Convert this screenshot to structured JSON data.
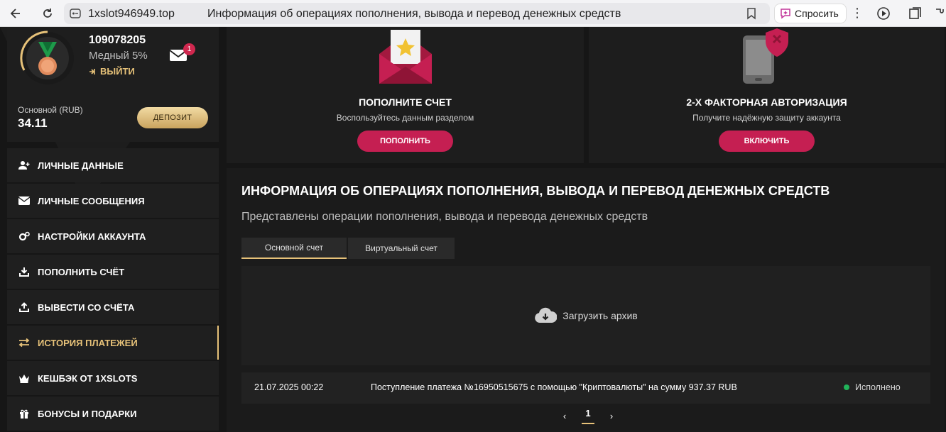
{
  "browser": {
    "url": "1xslot946949.top",
    "title": "Информация об операциях пополнения, вывода и перевод денежных средств",
    "ask_label": "Спросить"
  },
  "profile": {
    "user_id": "109078205",
    "level": "Медный 5%",
    "logout_label": "ВЫЙТИ",
    "mail_count": "1",
    "balance_label": "Основной (RUB)",
    "balance_value": "34.11",
    "deposit_label": "ДЕПОЗИТ"
  },
  "menu": {
    "items": [
      {
        "label": "ЛИЧНЫЕ ДАННЫЕ",
        "icon": "user-add-icon"
      },
      {
        "label": "ЛИЧНЫЕ СООБЩЕНИЯ",
        "icon": "envelope-icon"
      },
      {
        "label": "НАСТРОЙКИ АККАУНТА",
        "icon": "gears-icon"
      },
      {
        "label": "ПОПОЛНИТЬ СЧЁТ",
        "icon": "download-icon"
      },
      {
        "label": "ВЫВЕСТИ СО СЧЁТА",
        "icon": "upload-icon"
      },
      {
        "label": "ИСТОРИЯ ПЛАТЕЖЕЙ",
        "icon": "exchange-icon",
        "active": true
      },
      {
        "label": "КЕШБЭК ОТ 1XSLOTS",
        "icon": "crown-icon"
      },
      {
        "label": "БОНУСЫ И ПОДАРКИ",
        "icon": "gift-icon"
      }
    ]
  },
  "cards": {
    "deposit": {
      "title": "ПОПОЛНИТЕ СЧЕТ",
      "subtitle": "Воспользуйтесь данным разделом",
      "button": "ПОПОЛНИТЬ"
    },
    "twofa": {
      "title": "2-Х ФАКТОРНАЯ АВТОРИЗАЦИЯ",
      "subtitle": "Получите надёжную защиту аккаунта",
      "button": "ВКЛЮЧИТЬ"
    }
  },
  "panel": {
    "title": "ИНФОРМАЦИЯ ОБ ОПЕРАЦИЯХ ПОПОЛНЕНИЯ, ВЫВОДА И ПЕРЕВОД ДЕНЕЖНЫХ СРЕДСТВ",
    "subtitle": "Представлены операции пополнения, вывода и перевода денежных средств",
    "tabs": [
      "Основной счет",
      "Виртуальный счет"
    ],
    "archive_label": "Загрузить архив",
    "transactions": [
      {
        "date": "21.07.2025 00:22",
        "description": "Поступление платежа №16950515675 с помощью \"Криптовалюты\" на сумму 937.37 RUB",
        "status": "Исполнено"
      }
    ],
    "pagination": {
      "current": "1"
    }
  },
  "colors": {
    "accent_gold": "#e7c279",
    "button_pink": "#c51f52",
    "status_green": "#21b35a"
  }
}
